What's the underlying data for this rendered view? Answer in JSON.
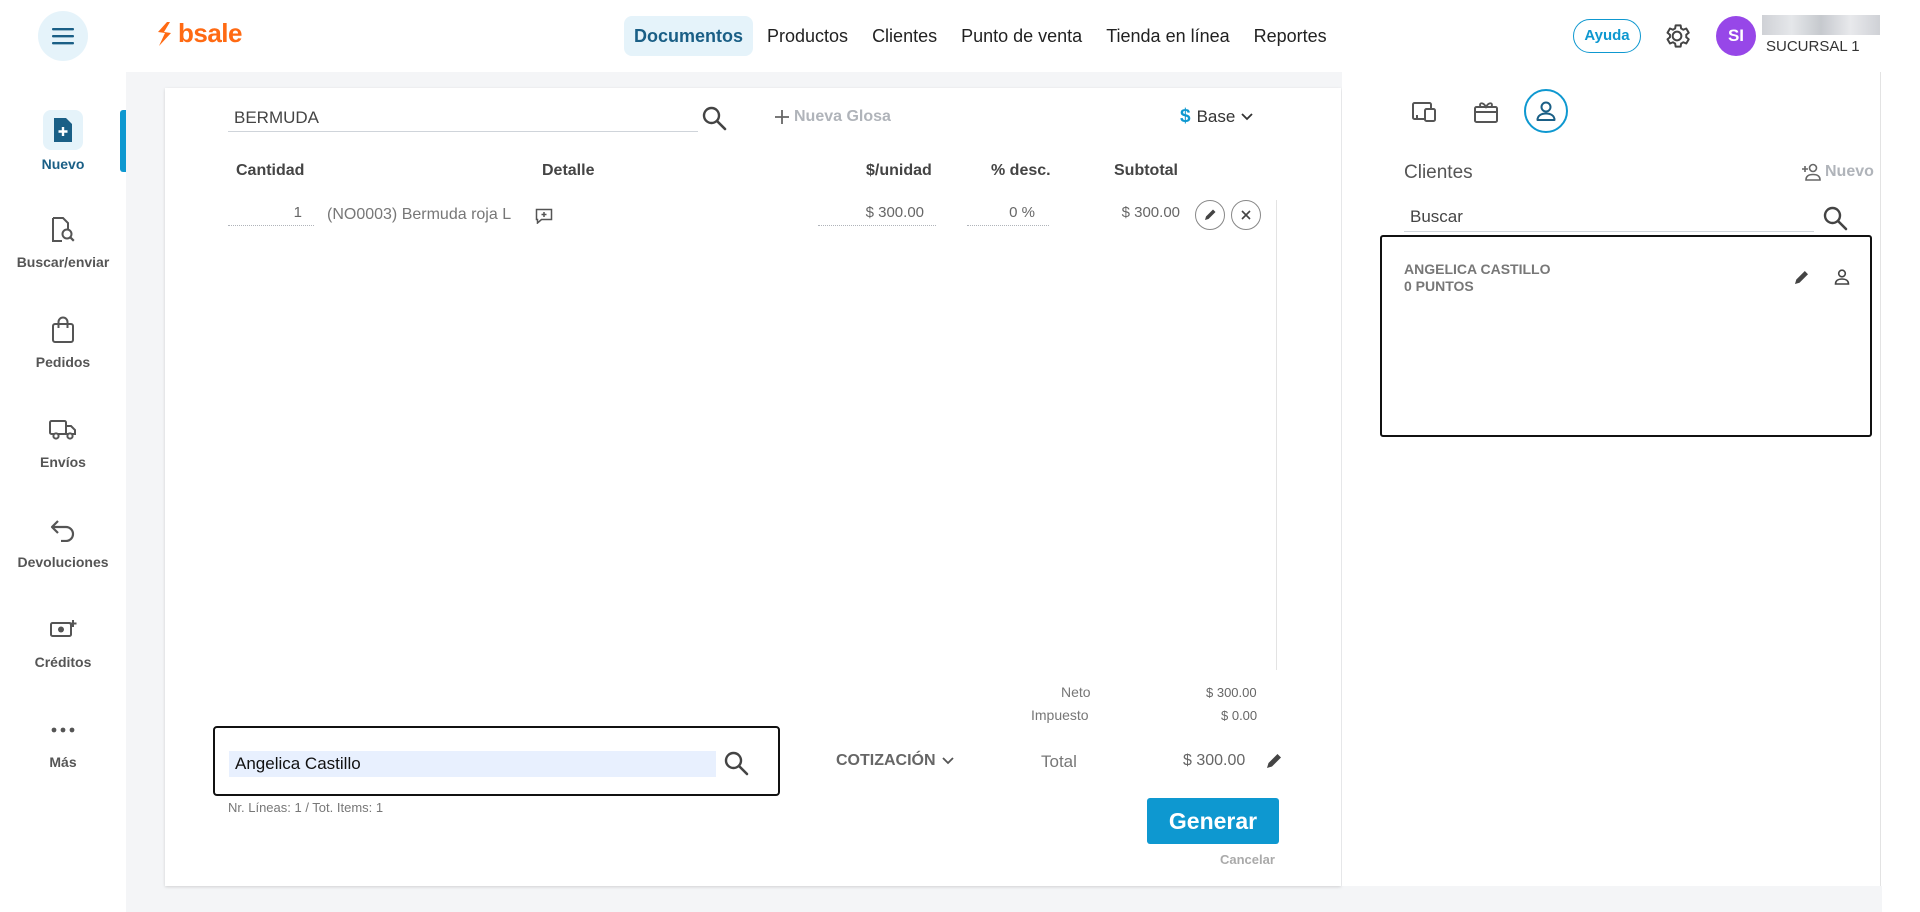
{
  "header": {
    "logo_text": "bsale",
    "nav": [
      "Documentos",
      "Productos",
      "Clientes",
      "Punto de venta",
      "Tienda en línea",
      "Reportes"
    ],
    "help": "Ayuda",
    "avatar_initials": "SI",
    "branch": "SUCURSAL 1"
  },
  "sidebar": {
    "items": [
      {
        "label": "Nuevo",
        "icon": "new-document-icon",
        "active": true
      },
      {
        "label": "Buscar/enviar",
        "icon": "search-document-icon"
      },
      {
        "label": "Pedidos",
        "icon": "shopping-bag-icon"
      },
      {
        "label": "Envíos",
        "icon": "truck-icon"
      },
      {
        "label": "Devoluciones",
        "icon": "return-arrow-icon"
      },
      {
        "label": "Créditos",
        "icon": "money-icon"
      },
      {
        "label": "Más",
        "icon": "more-icon"
      }
    ]
  },
  "document": {
    "product_search": "BERMUDA",
    "new_glosa": "Nueva Glosa",
    "price_list": "Base",
    "columns": {
      "quantity": "Cantidad",
      "detail": "Detalle",
      "unit_price": "$/unidad",
      "discount": "% desc.",
      "subtotal": "Subtotal"
    },
    "rows": [
      {
        "quantity": "1",
        "detail": "(NO0003) Bermuda roja L",
        "unit_price": "$ 300.00",
        "discount": "0 %",
        "subtotal": "$ 300.00"
      }
    ],
    "neto_label": "Neto",
    "neto_value": "$ 300.00",
    "impuesto_label": "Impuesto",
    "impuesto_value": "$ 0.00",
    "client_search_value": "Angelica Castillo",
    "line_count": "Nr. Líneas: 1 / Tot. Items: 1",
    "doc_type": "COTIZACIÓN",
    "total_label": "Total",
    "total_value": "$ 300.00",
    "generate": "Generar",
    "cancel": "Cancelar"
  },
  "client_panel": {
    "title": "Clientes",
    "new": "Nuevo",
    "search_placeholder": "Buscar",
    "client_name": "ANGELICA CASTILLO",
    "client_points": "0 PUNTOS"
  },
  "colors": {
    "brand": "#ff6a13",
    "accent": "#0e98d0",
    "avatar": "#9747e8"
  }
}
